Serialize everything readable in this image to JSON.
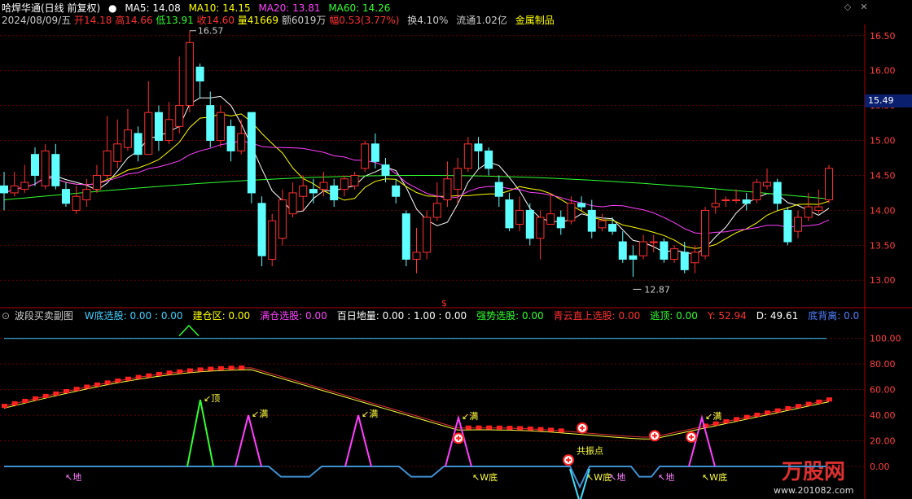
{
  "header": {
    "title": "哈焊华通(日线 前复权)",
    "ma5": "MA5: 14.08",
    "ma10": "MA10: 14.15",
    "ma20": "MA20: 13.81",
    "ma60": "MA60: 14.26",
    "date": "2024/08/09/五",
    "open": "开14.18",
    "high": "高14.66",
    "low": "低13.91",
    "close": "收14.60",
    "volume": "量41669",
    "amount": "额6019万",
    "change": "幅0.53(3.77%)",
    "turnover": "换4.10%",
    "float": "流通1.02亿",
    "sector": "金属制品"
  },
  "colors": {
    "ma5": "#ffffff",
    "ma10": "#ffff00",
    "ma20": "#ff40ff",
    "ma60": "#30ff30",
    "up": "#ff3030",
    "down": "#60ffff",
    "grid": "#6a0000",
    "axis": "#ff4040"
  },
  "price_axis": {
    "ticks": [
      "16.50",
      "16.00",
      "15.50",
      "15.00",
      "14.50",
      "14.00",
      "13.50",
      "13.00"
    ],
    "current_tag": "15.49",
    "high_label": "16.57",
    "low_label": "12.87",
    "marker": "$"
  },
  "indicator": {
    "name": "波段买卖副图",
    "items": [
      {
        "label": "W底选股: 0.00 : 0.00",
        "color": "#40d0ff"
      },
      {
        "label": "建仓区: 0.00",
        "color": "#ffff00"
      },
      {
        "label": "满仓选股: 0.00",
        "color": "#ff40ff"
      },
      {
        "label": "百日地量: 0.00 : 1.00 : 0.00",
        "color": "#ffffff"
      },
      {
        "label": "强势选股: 0.00",
        "color": "#30ff30"
      },
      {
        "label": "青云直上选股: 0.00",
        "color": "#ff3030"
      },
      {
        "label": "逃顶: 0.00",
        "color": "#30ff30"
      },
      {
        "label": "Y: 52.94",
        "color": "#ff3030"
      },
      {
        "label": "D: 49.61",
        "color": "#ffffff"
      },
      {
        "label": "底背离: 0.0",
        "color": "#5080ff"
      }
    ],
    "ticks": [
      "100.00",
      "80.00",
      "60.00",
      "40.00",
      "20.00",
      "0.00"
    ],
    "annotations": {
      "top": "顶",
      "full": "满",
      "bottom": "地",
      "wbottom": "W底",
      "resonance": "共振点"
    }
  },
  "watermark": {
    "brand": "万股网",
    "url": "www.201082.com"
  },
  "chart_data": {
    "type": "candlestick",
    "title": "哈焊华通(日线 前复权)",
    "ylim": [
      12.7,
      16.8
    ],
    "candles": [
      [
        14.35,
        14.25,
        14.55,
        14.0
      ],
      [
        14.25,
        14.35,
        14.55,
        14.2
      ],
      [
        14.3,
        14.4,
        14.65,
        14.25
      ],
      [
        14.8,
        14.5,
        14.9,
        14.35
      ],
      [
        14.35,
        14.85,
        14.95,
        14.3
      ],
      [
        14.8,
        14.35,
        14.95,
        14.3
      ],
      [
        14.3,
        14.1,
        14.4,
        14.05
      ],
      [
        14.0,
        14.2,
        14.35,
        13.95
      ],
      [
        14.15,
        14.3,
        14.45,
        14.05
      ],
      [
        14.3,
        14.5,
        14.65,
        14.25
      ],
      [
        14.5,
        14.85,
        15.35,
        14.45
      ],
      [
        14.7,
        14.95,
        15.3,
        14.6
      ],
      [
        14.9,
        15.15,
        15.45,
        14.85
      ],
      [
        15.1,
        14.8,
        15.2,
        14.7
      ],
      [
        14.8,
        15.4,
        15.85,
        14.8
      ],
      [
        15.4,
        15.0,
        15.5,
        14.85
      ],
      [
        15.0,
        15.3,
        15.55,
        14.95
      ],
      [
        15.2,
        15.5,
        16.2,
        15.1
      ],
      [
        15.5,
        16.4,
        16.57,
        15.4
      ],
      [
        16.05,
        15.85,
        16.1,
        15.6
      ],
      [
        15.5,
        15.0,
        15.7,
        14.9
      ],
      [
        15.0,
        15.4,
        15.5,
        14.9
      ],
      [
        15.2,
        14.85,
        15.3,
        14.7
      ],
      [
        14.85,
        15.1,
        15.3,
        14.8
      ],
      [
        15.4,
        14.25,
        15.4,
        14.1
      ],
      [
        14.1,
        13.35,
        14.2,
        13.2
      ],
      [
        13.3,
        13.85,
        13.95,
        13.2
      ],
      [
        13.6,
        14.15,
        14.3,
        13.5
      ],
      [
        13.95,
        14.25,
        14.4,
        13.9
      ],
      [
        14.2,
        14.35,
        14.5,
        14.0
      ],
      [
        14.3,
        14.25,
        14.45,
        14.1
      ],
      [
        14.3,
        14.4,
        14.55,
        14.2
      ],
      [
        14.35,
        14.15,
        14.45,
        14.05
      ],
      [
        14.3,
        14.45,
        14.5,
        14.2
      ],
      [
        14.35,
        14.5,
        14.55,
        14.3
      ],
      [
        14.6,
        14.95,
        15.0,
        14.55
      ],
      [
        14.95,
        14.7,
        15.1,
        14.6
      ],
      [
        14.65,
        14.5,
        14.75,
        14.4
      ],
      [
        14.35,
        14.2,
        14.45,
        14.1
      ],
      [
        13.95,
        13.3,
        14.0,
        13.2
      ],
      [
        13.3,
        13.4,
        13.75,
        13.1
      ],
      [
        13.4,
        13.9,
        14.0,
        13.3
      ],
      [
        13.9,
        14.1,
        14.4,
        13.85
      ],
      [
        14.15,
        14.45,
        14.7,
        14.05
      ],
      [
        14.3,
        14.6,
        14.75,
        14.1
      ],
      [
        14.6,
        14.95,
        15.05,
        14.55
      ],
      [
        14.95,
        14.85,
        15.05,
        14.6
      ],
      [
        14.85,
        14.6,
        14.9,
        14.5
      ],
      [
        14.4,
        14.2,
        14.5,
        14.05
      ],
      [
        14.15,
        13.75,
        14.25,
        13.7
      ],
      [
        13.8,
        14.0,
        14.2,
        13.7
      ],
      [
        14.0,
        13.6,
        14.1,
        13.5
      ],
      [
        13.6,
        13.9,
        14.0,
        13.3
      ],
      [
        13.8,
        13.95,
        14.25,
        13.8
      ],
      [
        13.9,
        13.75,
        14.0,
        13.65
      ],
      [
        13.85,
        14.1,
        14.2,
        13.8
      ],
      [
        14.1,
        14.05,
        14.2,
        14.0
      ],
      [
        14.0,
        13.7,
        14.15,
        13.6
      ],
      [
        13.75,
        13.85,
        13.95,
        13.7
      ],
      [
        13.8,
        13.7,
        13.9,
        13.65
      ],
      [
        13.55,
        13.3,
        13.7,
        13.25
      ],
      [
        13.35,
        13.3,
        13.5,
        13.05
      ],
      [
        13.35,
        13.55,
        13.65,
        13.3
      ],
      [
        13.55,
        13.55,
        13.65,
        13.4
      ],
      [
        13.55,
        13.3,
        13.6,
        13.25
      ],
      [
        13.3,
        13.45,
        13.5,
        13.25
      ],
      [
        13.4,
        13.15,
        13.55,
        13.1
      ],
      [
        13.25,
        13.4,
        13.5,
        13.1
      ],
      [
        13.35,
        14.0,
        14.05,
        13.3
      ],
      [
        14.05,
        14.1,
        14.3,
        13.95
      ],
      [
        14.15,
        14.15,
        14.2,
        14.05
      ],
      [
        14.15,
        14.15,
        14.3,
        14.1
      ],
      [
        14.15,
        14.1,
        14.25,
        14.0
      ],
      [
        14.15,
        14.4,
        14.45,
        14.1
      ],
      [
        14.35,
        14.4,
        14.6,
        14.3
      ],
      [
        14.4,
        14.1,
        14.45,
        14.0
      ],
      [
        14.0,
        13.55,
        14.05,
        13.5
      ],
      [
        13.7,
        13.9,
        14.0,
        13.6
      ],
      [
        13.9,
        14.05,
        14.25,
        13.85
      ],
      [
        14.0,
        14.05,
        14.3,
        13.95
      ],
      [
        14.15,
        14.6,
        14.65,
        14.1
      ]
    ],
    "ma": {
      "MA5": 14.08,
      "MA10": 14.15,
      "MA20": 13.81,
      "MA60": 14.26
    },
    "subchart": {
      "ylim": [
        0,
        110
      ],
      "Y": 52.94,
      "D": 49.61
    }
  }
}
